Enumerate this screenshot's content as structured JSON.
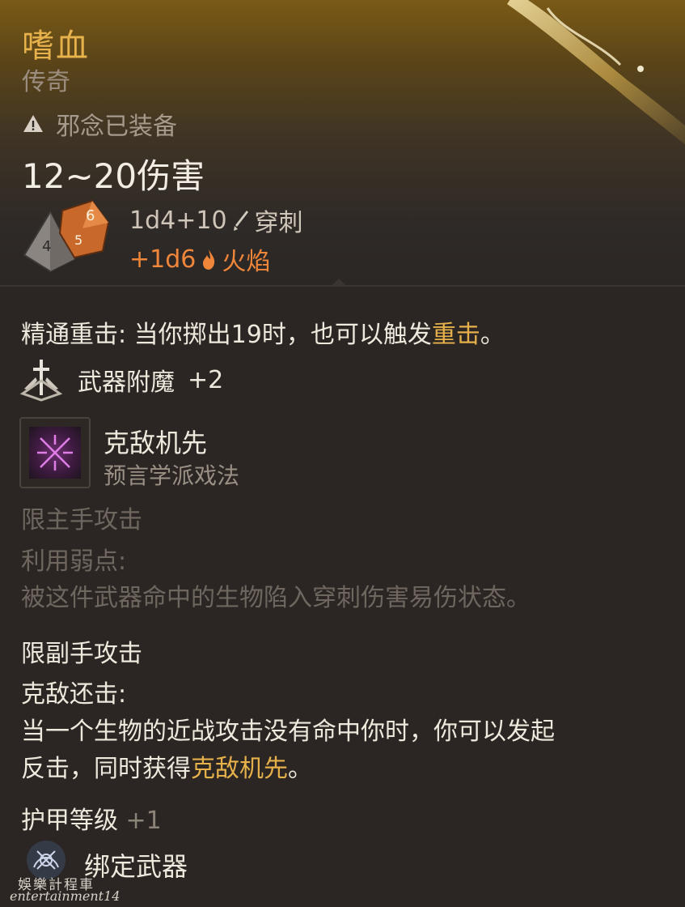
{
  "item": {
    "name": "嗜血",
    "rarity": "传奇",
    "warning": "邪念已装备",
    "damage": "12~20伤害",
    "roll1_value": "1d4+10",
    "roll1_type": "穿刺",
    "roll2_value": "+1d6",
    "roll2_type": "火焰"
  },
  "properties": {
    "crit_label": "精通重击",
    "crit_text_1": ": 当你掷出19时，也可以触发",
    "crit_highlight": "重击",
    "crit_end": "。",
    "enchant_label": "武器附魔",
    "enchant_bonus": "+2",
    "spell_name": "克敌机先",
    "spell_school": "预言学派戏法",
    "mainhand_header": "限主手攻击",
    "mainhand_ability": "利用弱点:",
    "mainhand_desc": "被这件武器命中的生物陷入穿刺伤害易伤状态。",
    "offhand_header": "限副手攻击",
    "offhand_ability": "克敌还击:",
    "offhand_desc_1": "当一个生物的近战攻击没有命中你时，你可以发起",
    "offhand_desc_2a": "反击，同时获得",
    "offhand_desc_highlight": "克敌机先",
    "offhand_desc_2b": "。",
    "armor_label": "护甲等级",
    "armor_bonus": "+1",
    "bound_label": "绑定武器"
  },
  "watermark": {
    "line1": "娛樂計程車",
    "line2": "entertainment14"
  },
  "colors": {
    "title": "#e6b04a",
    "fire": "#f0863a",
    "background": "#2b2623"
  },
  "icons": [
    "warning-icon",
    "pierce-icon",
    "fire-icon",
    "dice-icon",
    "enchant-icon",
    "spell-icon",
    "bound-weapon-icon"
  ]
}
